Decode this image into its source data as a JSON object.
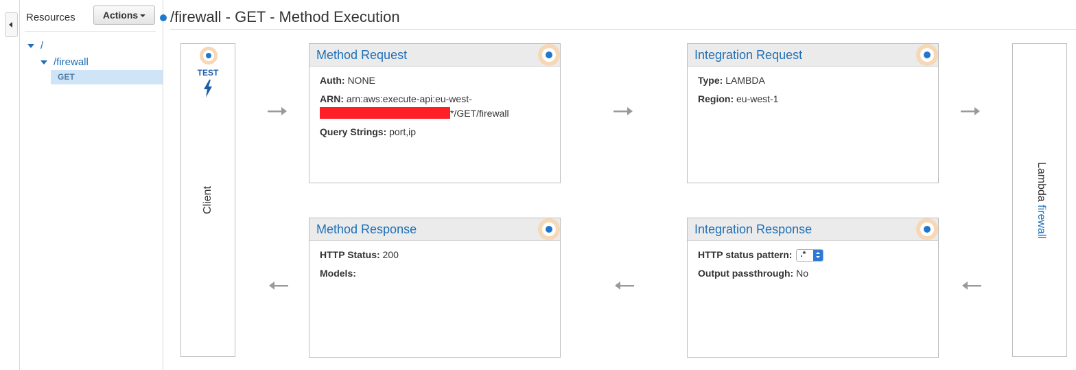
{
  "sidebar": {
    "title": "Resources",
    "actions_label": "Actions",
    "tree": [
      {
        "label": "/"
      },
      {
        "label": "/firewall"
      },
      {
        "label": "GET"
      }
    ]
  },
  "page": {
    "title": "/firewall - GET - Method Execution"
  },
  "client": {
    "test_label": "TEST",
    "label": "Client"
  },
  "lambda": {
    "prefix": "Lambda",
    "function_name": "firewall"
  },
  "method_request": {
    "title": "Method Request",
    "auth_label": "Auth:",
    "auth_value": "NONE",
    "arn_label": "ARN:",
    "arn_value_line1": "arn:aws:execute-api:eu-west-",
    "arn_value_line2_suffix": "*/GET/firewall",
    "query_label": "Query Strings:",
    "query_value": "port,ip"
  },
  "integration_request": {
    "title": "Integration Request",
    "type_label": "Type:",
    "type_value": "LAMBDA",
    "region_label": "Region:",
    "region_value": "eu-west-1"
  },
  "method_response": {
    "title": "Method Response",
    "status_label": "HTTP Status:",
    "status_value": "200",
    "models_label": "Models:"
  },
  "integration_response": {
    "title": "Integration Response",
    "pattern_label": "HTTP status pattern:",
    "pattern_value": ".*",
    "passthrough_label": "Output passthrough:",
    "passthrough_value": "No"
  },
  "colors": {
    "accent": "#1f6fb7",
    "badge_ring": "#f6d7b6",
    "badge_dot": "#1f77d0",
    "redaction": "#ff1f26"
  }
}
